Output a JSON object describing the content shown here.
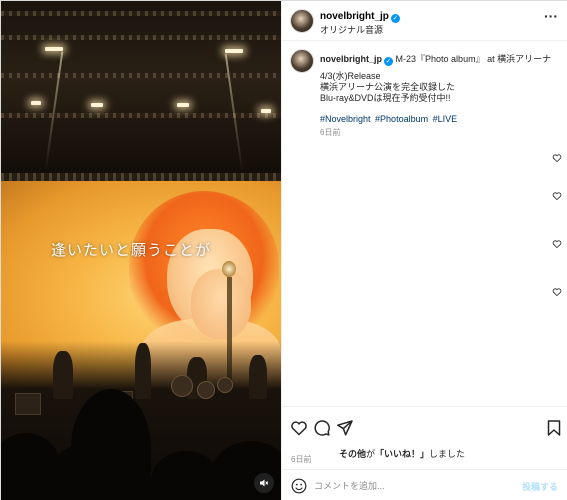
{
  "header": {
    "username": "novelbright_jp",
    "verified": true,
    "audio_label": "オリジナル音源",
    "more_icon": "more-dots-icon"
  },
  "caption": {
    "username": "novelbright_jp",
    "title_text": "M-23『Photo album』 at 横浜アリーナ",
    "lines": [
      "4/3(水)Release",
      "横浜アリーナ公演を完全収録した",
      "Blu-ray&DVDは現在予約受付中!!"
    ],
    "hashtags": [
      "#Novelbright",
      "#Photoalbum",
      "#LIVE"
    ],
    "time_ago": "6日前"
  },
  "media": {
    "lyric_overlay": "逢いたいと願うことが",
    "mute_icon": "speaker-muted-icon"
  },
  "actions": {
    "like_icon": "heart-icon",
    "comment_icon": "comment-icon",
    "share_icon": "share-icon",
    "save_icon": "bookmark-icon",
    "likes_prefix": "その他",
    "likes_middle": "が",
    "likes_quote": "「いいね！」",
    "likes_suffix": "しました",
    "date": "6日前"
  },
  "comment_box": {
    "placeholder": "コメントを追加...",
    "post_label": "投稿する"
  },
  "colors": {
    "verified_blue": "#0095f6",
    "hashtag_blue": "#00376b",
    "muted_text": "#8e8e8e",
    "post_disabled": "#b2dffc"
  }
}
